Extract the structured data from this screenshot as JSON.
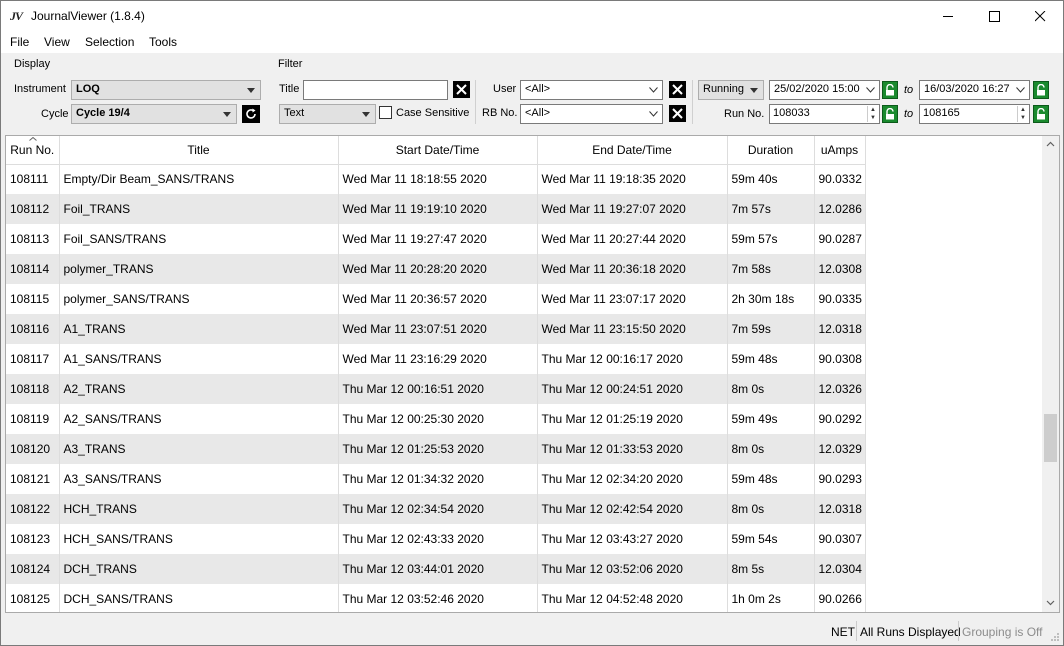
{
  "app": {
    "icon_text": "JV",
    "title": "JournalViewer (1.8.4)"
  },
  "menu": [
    "File",
    "View",
    "Selection",
    "Tools"
  ],
  "display": {
    "group_label": "Display",
    "instrument_label": "Instrument",
    "instrument_value": "LOQ",
    "cycle_label": "Cycle",
    "cycle_value": "Cycle 19/4"
  },
  "filter": {
    "group_label": "Filter",
    "title_label": "Title",
    "title_value": "",
    "match_mode": "Text",
    "case_sensitive_label": "Case Sensitive",
    "case_sensitive_checked": false,
    "user_label": "User",
    "user_value": "<All>",
    "rb_label": "RB No.",
    "rb_value": "<All>",
    "state_value": "Running",
    "date_from": "25/02/2020 15:00",
    "to_label_1": "to",
    "date_to": "16/03/2020 16:27",
    "run_no_label": "Run No.",
    "run_from": "108033",
    "to_label_2": "to",
    "run_to": "108165"
  },
  "table": {
    "columns": [
      "Run No.",
      "Title",
      "Start Date/Time",
      "End Date/Time",
      "Duration",
      "uAmps"
    ],
    "rows": [
      [
        "108111",
        "Empty/Dir Beam_SANS/TRANS",
        "Wed Mar 11 18:18:55 2020",
        "Wed Mar 11 19:18:35 2020",
        "59m 40s",
        "90.0332"
      ],
      [
        "108112",
        "Foil_TRANS",
        "Wed Mar 11 19:19:10 2020",
        "Wed Mar 11 19:27:07 2020",
        "7m 57s",
        "12.0286"
      ],
      [
        "108113",
        "Foil_SANS/TRANS",
        "Wed Mar 11 19:27:47 2020",
        "Wed Mar 11 20:27:44 2020",
        "59m 57s",
        "90.0287"
      ],
      [
        "108114",
        "polymer_TRANS",
        "Wed Mar 11 20:28:20 2020",
        "Wed Mar 11 20:36:18 2020",
        "7m 58s",
        "12.0308"
      ],
      [
        "108115",
        "polymer_SANS/TRANS",
        "Wed Mar 11 20:36:57 2020",
        "Wed Mar 11 23:07:17 2020",
        "2h 30m 18s",
        "90.0335"
      ],
      [
        "108116",
        "A1_TRANS",
        "Wed Mar 11 23:07:51 2020",
        "Wed Mar 11 23:15:50 2020",
        "7m 59s",
        "12.0318"
      ],
      [
        "108117",
        "A1_SANS/TRANS",
        "Wed Mar 11 23:16:29 2020",
        "Thu Mar 12 00:16:17 2020",
        "59m 48s",
        "90.0308"
      ],
      [
        "108118",
        "A2_TRANS",
        "Thu Mar 12 00:16:51 2020",
        "Thu Mar 12 00:24:51 2020",
        "8m 0s",
        "12.0326"
      ],
      [
        "108119",
        "A2_SANS/TRANS",
        "Thu Mar 12 00:25:30 2020",
        "Thu Mar 12 01:25:19 2020",
        "59m 49s",
        "90.0292"
      ],
      [
        "108120",
        "A3_TRANS",
        "Thu Mar 12 01:25:53 2020",
        "Thu Mar 12 01:33:53 2020",
        "8m 0s",
        "12.0329"
      ],
      [
        "108121",
        "A3_SANS/TRANS",
        "Thu Mar 12 01:34:32 2020",
        "Thu Mar 12 02:34:20 2020",
        "59m 48s",
        "90.0293"
      ],
      [
        "108122",
        "HCH_TRANS",
        "Thu Mar 12 02:34:54 2020",
        "Thu Mar 12 02:42:54 2020",
        "8m 0s",
        "12.0318"
      ],
      [
        "108123",
        "HCH_SANS/TRANS",
        "Thu Mar 12 02:43:33 2020",
        "Thu Mar 12 03:43:27 2020",
        "59m 54s",
        "90.0307"
      ],
      [
        "108124",
        "DCH_TRANS",
        "Thu Mar 12 03:44:01 2020",
        "Thu Mar 12 03:52:06 2020",
        "8m 5s",
        "12.0304"
      ],
      [
        "108125",
        "DCH_SANS/TRANS",
        "Thu Mar 12 03:52:46 2020",
        "Thu Mar 12 04:52:48 2020",
        "1h 0m 2s",
        "90.0266"
      ]
    ]
  },
  "status": {
    "net": "NET",
    "runs": "All Runs Displayed",
    "grouping": "Grouping is Off"
  },
  "colors": {
    "lock_green": "#1a8a2e",
    "row_alt": "#e8e8e8",
    "grouping_text": "#8c8c8c"
  }
}
